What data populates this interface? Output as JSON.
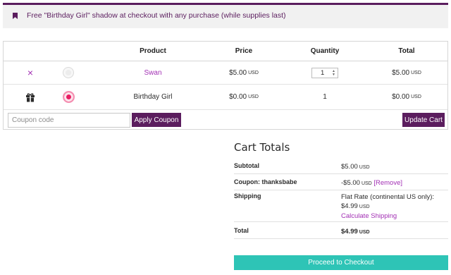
{
  "notice": {
    "text": "Free \"Birthday Girl\" shadow at checkout with any purchase (while supplies last)"
  },
  "cart": {
    "headers": {
      "product": "Product",
      "price": "Price",
      "quantity": "Quantity",
      "total": "Total"
    },
    "rows": [
      {
        "remove_icon": "×",
        "product": "Swan",
        "price": "$5.00",
        "price_currency": "USD",
        "quantity": "1",
        "total": "$5.00",
        "total_currency": "USD"
      },
      {
        "product": "Birthday Girl",
        "price": "$0.00",
        "price_currency": "USD",
        "quantity": "1",
        "total": "$0.00",
        "total_currency": "USD"
      }
    ],
    "coupon_placeholder": "Coupon code",
    "apply_coupon_label": "Apply Coupon",
    "update_cart_label": "Update Cart"
  },
  "totals": {
    "title": "Cart Totals",
    "subtotal_label": "Subtotal",
    "subtotal_value": "$5.00",
    "subtotal_currency": "USD",
    "coupon_label": "Coupon: thanksbabe",
    "coupon_value": "-$5.00",
    "coupon_currency": "USD",
    "coupon_remove": "[Remove]",
    "shipping_label": "Shipping",
    "shipping_method": "Flat Rate (continental US only):",
    "shipping_value": "$4.99",
    "shipping_currency": "USD",
    "calculate_shipping": "Calculate Shipping",
    "total_label": "Total",
    "total_value": "$4.99",
    "total_currency": "USD",
    "checkout_label": "Proceed to Checkout"
  },
  "colors": {
    "brand_purple": "#5b1d5e",
    "link_purple": "#a22fb4",
    "checkout_teal": "#2ec4b6"
  }
}
